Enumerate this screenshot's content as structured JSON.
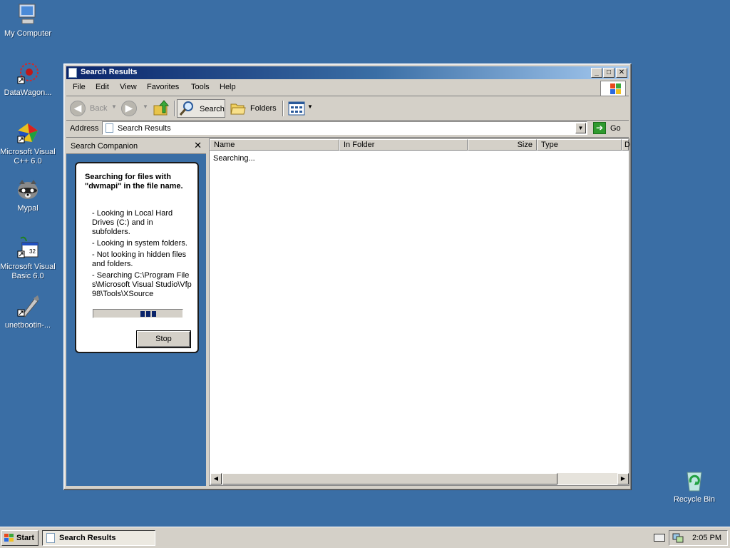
{
  "desktop": {
    "icons": [
      {
        "label": "My Computer"
      },
      {
        "label": "DataWagon..."
      },
      {
        "label": "Microsoft Visual C++ 6.0"
      },
      {
        "label": "Mypal"
      },
      {
        "label": "Microsoft Visual Basic 6.0"
      },
      {
        "label": "unetbootin-..."
      },
      {
        "label": "Recycle Bin"
      }
    ]
  },
  "window": {
    "title": "Search Results",
    "controls": {
      "minimize": "_",
      "maximize": "□",
      "close": "✕"
    },
    "menu": [
      "File",
      "Edit",
      "View",
      "Favorites",
      "Tools",
      "Help"
    ],
    "toolbar": {
      "back_label": "Back",
      "search_label": "Search",
      "folders_label": "Folders"
    },
    "address": {
      "label": "Address",
      "value": "Search Results",
      "go_label": "Go"
    },
    "companion": {
      "header": "Search Companion",
      "close_glyph": "✕",
      "heading": "Searching for files with \"dwmapi\" in the file name.",
      "criteria": [
        "- Looking in Local Hard Drives (C:) and in subfolders.",
        "- Looking in system folders.",
        "- Not looking in hidden files and folders.",
        "- Searching C:\\Program Files\\Microsoft Visual Studio\\Vfp98\\Tools\\XSource"
      ],
      "stop_label": "Stop"
    },
    "results": {
      "columns": [
        "Name",
        "In Folder",
        "Size",
        "Type",
        "D"
      ],
      "status": "Searching..."
    }
  },
  "taskbar": {
    "start_label": "Start",
    "task_label": "Search Results",
    "clock": "2:05 PM"
  },
  "colors": {
    "desktop": "#3a6ea5",
    "title_active": "#0a246a",
    "face": "#d4d0c8"
  }
}
